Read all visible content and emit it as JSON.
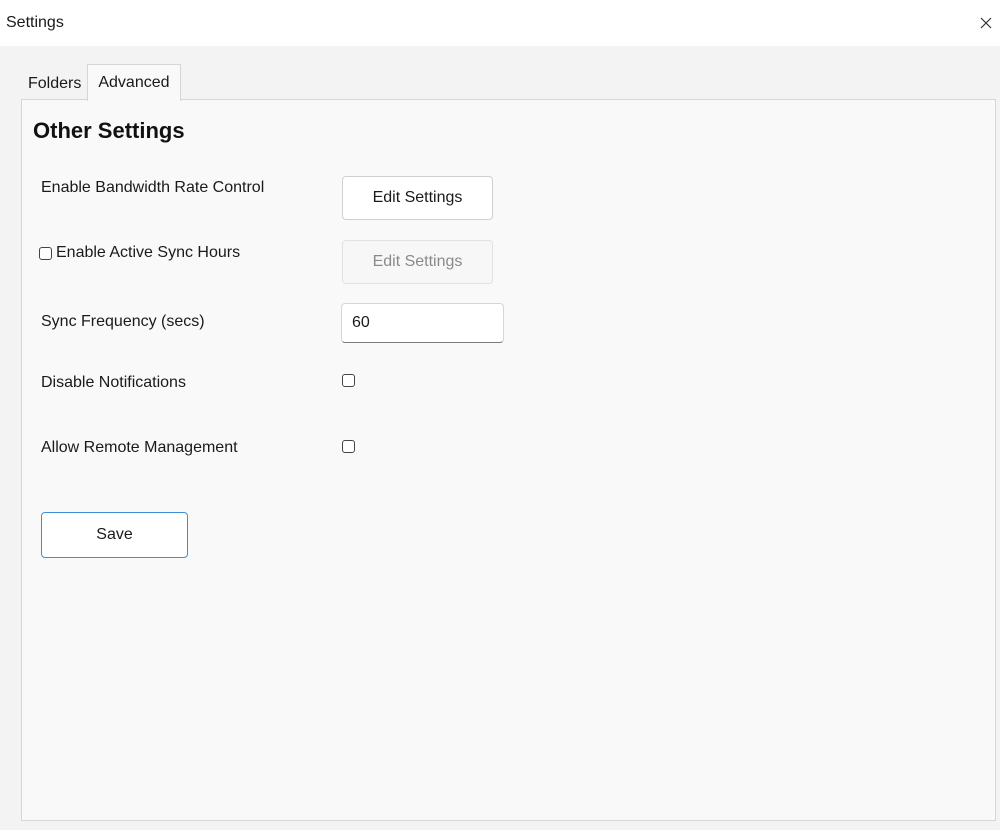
{
  "window": {
    "title": "Settings",
    "close_icon": "close-icon"
  },
  "tabs": [
    {
      "label": "Folders",
      "active": false
    },
    {
      "label": "Advanced",
      "active": true
    }
  ],
  "advanced": {
    "section_title": "Other Settings",
    "bandwidth": {
      "label": "Enable Bandwidth Rate Control",
      "button_label": "Edit Settings"
    },
    "active_sync": {
      "label": "Enable Active Sync Hours",
      "checked": false,
      "button_label": "Edit Settings",
      "button_disabled": true
    },
    "sync_frequency": {
      "label": "Sync Frequency (secs)",
      "value": "60"
    },
    "notifications": {
      "label": "Disable Notifications",
      "checked": false
    },
    "remote_management": {
      "label": "Allow Remote Management",
      "checked": false
    },
    "save_label": "Save"
  },
  "colors": {
    "accent_border": "#3b8fd6",
    "panel_bg": "#f9f9f9",
    "window_bg": "#f3f3f3"
  }
}
